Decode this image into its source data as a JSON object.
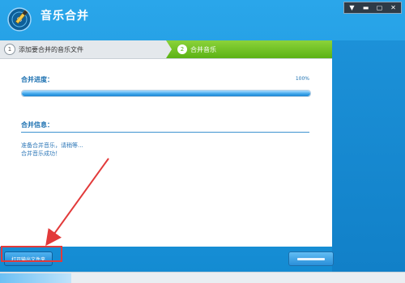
{
  "window": {
    "title": "音乐合并",
    "subtitle": "",
    "controls": {
      "menu": "▼",
      "minimize": "▬",
      "maximize": "▢",
      "close": "✕"
    }
  },
  "steps": [
    {
      "number": "1",
      "label": "添加要合并的音乐文件",
      "active": false
    },
    {
      "number": "2",
      "label": "合并音乐",
      "active": true
    }
  ],
  "progress": {
    "label": "合并进度：",
    "value_text": "100%",
    "value": 100
  },
  "info": {
    "label": "合并信息：",
    "lines": [
      "准备合并音乐，请稍等...",
      "合并音乐成功！"
    ]
  },
  "buttons": {
    "open_folder": "打开输出文件夹",
    "finish": ""
  },
  "icons": {
    "logo": "music-merge-logo-icon",
    "menu": "chevron-down-icon",
    "minimize": "minimize-icon",
    "maximize": "maximize-icon",
    "close": "close-icon"
  },
  "colors": {
    "title_bar": "#2aa6ea",
    "active_step": "#5bb214",
    "accent_text": "#1a6fb0",
    "annotation": "#e23a3a"
  }
}
